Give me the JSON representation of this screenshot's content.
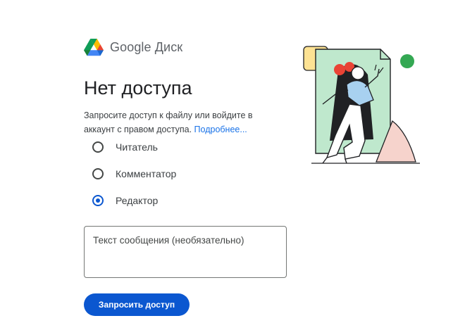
{
  "brand": {
    "name": "Google Диск",
    "logo_icon": "google-drive-icon"
  },
  "title": "Нет доступа",
  "description": {
    "text": "Запросите доступ к файлу или войдите в аккаунт с правом доступа.",
    "link": "Подробнее..."
  },
  "roles": [
    {
      "label": "Читатель",
      "selected": false
    },
    {
      "label": "Комментатор",
      "selected": false
    },
    {
      "label": "Редактор",
      "selected": true
    }
  ],
  "message": {
    "placeholder": "Текст сообщения (необязательно)",
    "value": ""
  },
  "request_button": "Запросить доступ",
  "colors": {
    "accent": "#0b57d0",
    "link": "#1a73e8",
    "illustration_green": "#bfe8cd",
    "illustration_yellow": "#fde293",
    "illustration_red": "#ea4335",
    "illustration_pink": "#f6d3cc",
    "illustration_dot": "#34a853"
  }
}
